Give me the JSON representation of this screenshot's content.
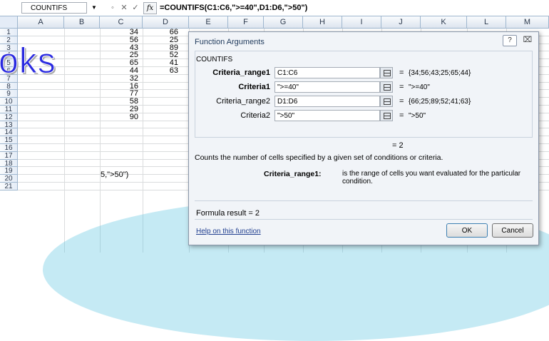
{
  "formula_bar": {
    "name_box": "COUNTIFS",
    "cancel_glyph": "✕",
    "enter_glyph": "✓",
    "fx_label": "fx",
    "formula": "=COUNTIFS(C1:C6,\">=40\",D1:D6,\">50\")"
  },
  "sheet": {
    "columns": [
      "A",
      "B",
      "C",
      "D",
      "E",
      "F",
      "G",
      "H",
      "I",
      "J",
      "K",
      "L",
      "M"
    ],
    "rows": [
      "1",
      "2",
      "3",
      "4",
      "5",
      "6",
      "7",
      "8",
      "9",
      "10",
      "11",
      "12",
      "13",
      "14",
      "15",
      "16",
      "17",
      "18",
      "19",
      "20",
      "21"
    ],
    "col_c": [
      "34",
      "56",
      "43",
      "25",
      "65",
      "44",
      "32",
      "16",
      "77",
      "58",
      "29",
      "90"
    ],
    "col_d": [
      "66",
      "25",
      "89",
      "52",
      "41",
      "63"
    ],
    "b14_text": "5,\">50\")",
    "watermark": "oks"
  },
  "dialog": {
    "title": "Function Arguments",
    "help_glyph": "?",
    "close_glyph": "⌧",
    "function_name": "COUNTIFS",
    "args": [
      {
        "label": "Criteria_range1",
        "bold": true,
        "value": "C1:C6",
        "result": "{34;56;43;25;65;44}"
      },
      {
        "label": "Criteria1",
        "bold": true,
        "value": "\">=40\"",
        "result": "\">=40\""
      },
      {
        "label": "Criteria_range2",
        "bold": false,
        "value": "D1:D6",
        "result": "{66;25;89;52;41;63}"
      },
      {
        "label": "Criteria2",
        "bold": false,
        "value": "\">50\"",
        "result": "\">50\""
      }
    ],
    "equals": "=",
    "result_line": "=  2",
    "description": "Counts the number of cells specified by a given set of conditions or criteria.",
    "arg_desc_name": "Criteria_range1:",
    "arg_desc_text": "is the range of cells you want evaluated for the particular condition.",
    "formula_result": "Formula result =   2",
    "help_link": "Help on this function",
    "ok_label": "OK",
    "cancel_label": "Cancel"
  }
}
